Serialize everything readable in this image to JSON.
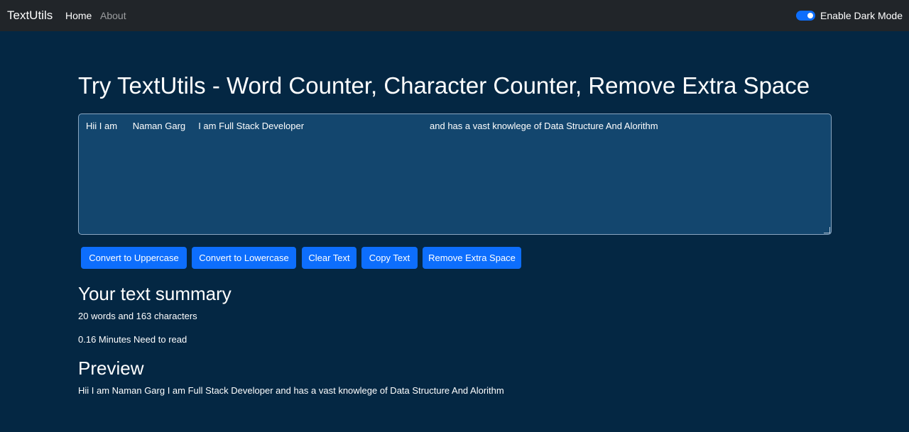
{
  "navbar": {
    "brand": "TextUtils",
    "links": [
      {
        "label": "Home",
        "active": true
      },
      {
        "label": "About",
        "active": false
      }
    ],
    "dark_mode_toggle": {
      "label": "Enable Dark Mode",
      "checked": true
    }
  },
  "main": {
    "title": "Try TextUtils - Word Counter, Character Counter, Remove Extra Space",
    "textarea_value": "Hii I am      Naman Garg     I am Full Stack Developer                                                 and has a vast knowlege of Data Structure And Alorithm",
    "buttons": [
      {
        "label": "Convert to Uppercase"
      },
      {
        "label": "Convert to Lowercase"
      },
      {
        "label": "Clear Text"
      },
      {
        "label": "Copy Text"
      },
      {
        "label": "Remove Extra Space"
      }
    ],
    "summary_heading": "Your text summary",
    "summary_counts": "20 words and 163 characters",
    "read_time": "0.16 Minutes Need to read",
    "preview_heading": "Preview",
    "preview_text": "Hii I am Naman Garg I am Full Stack Developer and has a vast knowlege of Data Structure And Alorithm"
  },
  "colors": {
    "background": "#042743",
    "navbar": "#212529",
    "textarea": "#13466e",
    "primary_button": "#0d6efd"
  }
}
